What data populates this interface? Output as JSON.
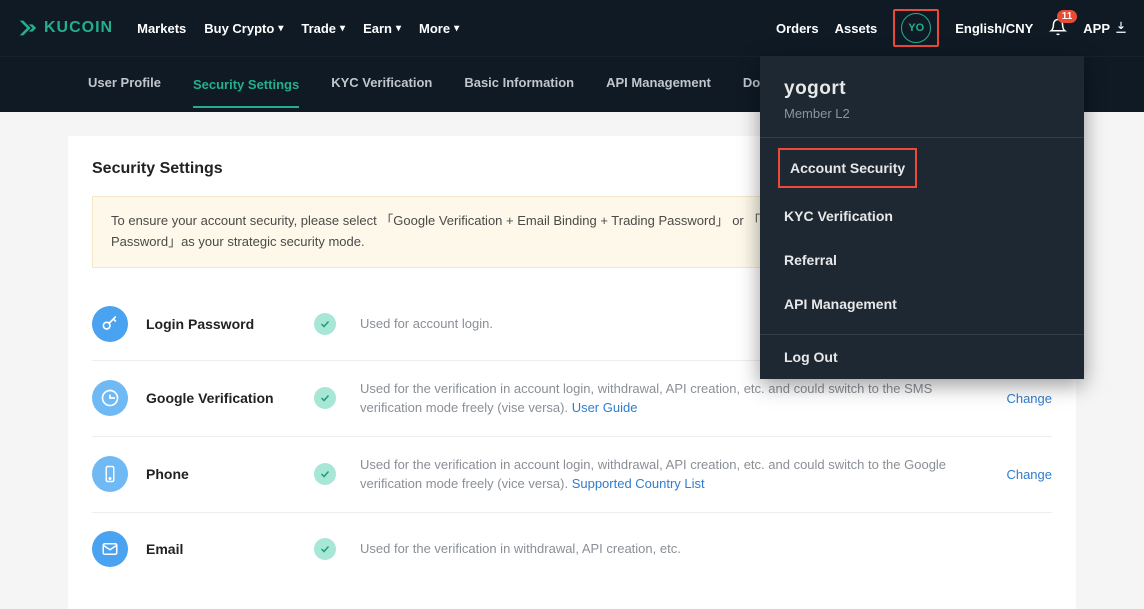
{
  "header": {
    "brand": "KUCOIN",
    "nav": [
      "Markets",
      "Buy Crypto",
      "Trade",
      "Earn",
      "More"
    ],
    "orders": "Orders",
    "assets": "Assets",
    "avatar": "YO",
    "lang": "English/CNY",
    "notif_count": "11",
    "app": "APP"
  },
  "subnav": {
    "items": [
      "User Profile",
      "Security Settings",
      "KYC Verification",
      "Basic Information",
      "API Management",
      "Download History"
    ],
    "active_index": 1
  },
  "section": {
    "title": "Security Settings",
    "notice": "To ensure your account security, please select 「Google Verification + Email Binding + Trading Password」 or 「Phone Verification + Email Binding + Trading Password」as your strategic security mode."
  },
  "rows": [
    {
      "icon": "key",
      "label": "Login Password",
      "desc": "Used for account login.",
      "link": null,
      "action": null
    },
    {
      "icon": "google",
      "label": "Google Verification",
      "desc": "Used for the verification in account login, withdrawal, API creation, etc. and could switch to the SMS verification mode freely (vise versa). ",
      "link": "User Guide",
      "action": "Change"
    },
    {
      "icon": "phone",
      "label": "Phone",
      "desc": "Used for the verification in account login, withdrawal, API creation, etc. and could switch to the Google verification mode freely (vice versa). ",
      "link": "Supported Country List",
      "action": "Change"
    },
    {
      "icon": "email",
      "label": "Email",
      "desc": "Used for the verification in withdrawal, API creation, etc.",
      "link": null,
      "action": null
    }
  ],
  "dropdown": {
    "name": "yogort",
    "level": "Member L2",
    "items": [
      "Account Security",
      "KYC Verification",
      "Referral",
      "API Management"
    ],
    "logout": "Log Out"
  }
}
